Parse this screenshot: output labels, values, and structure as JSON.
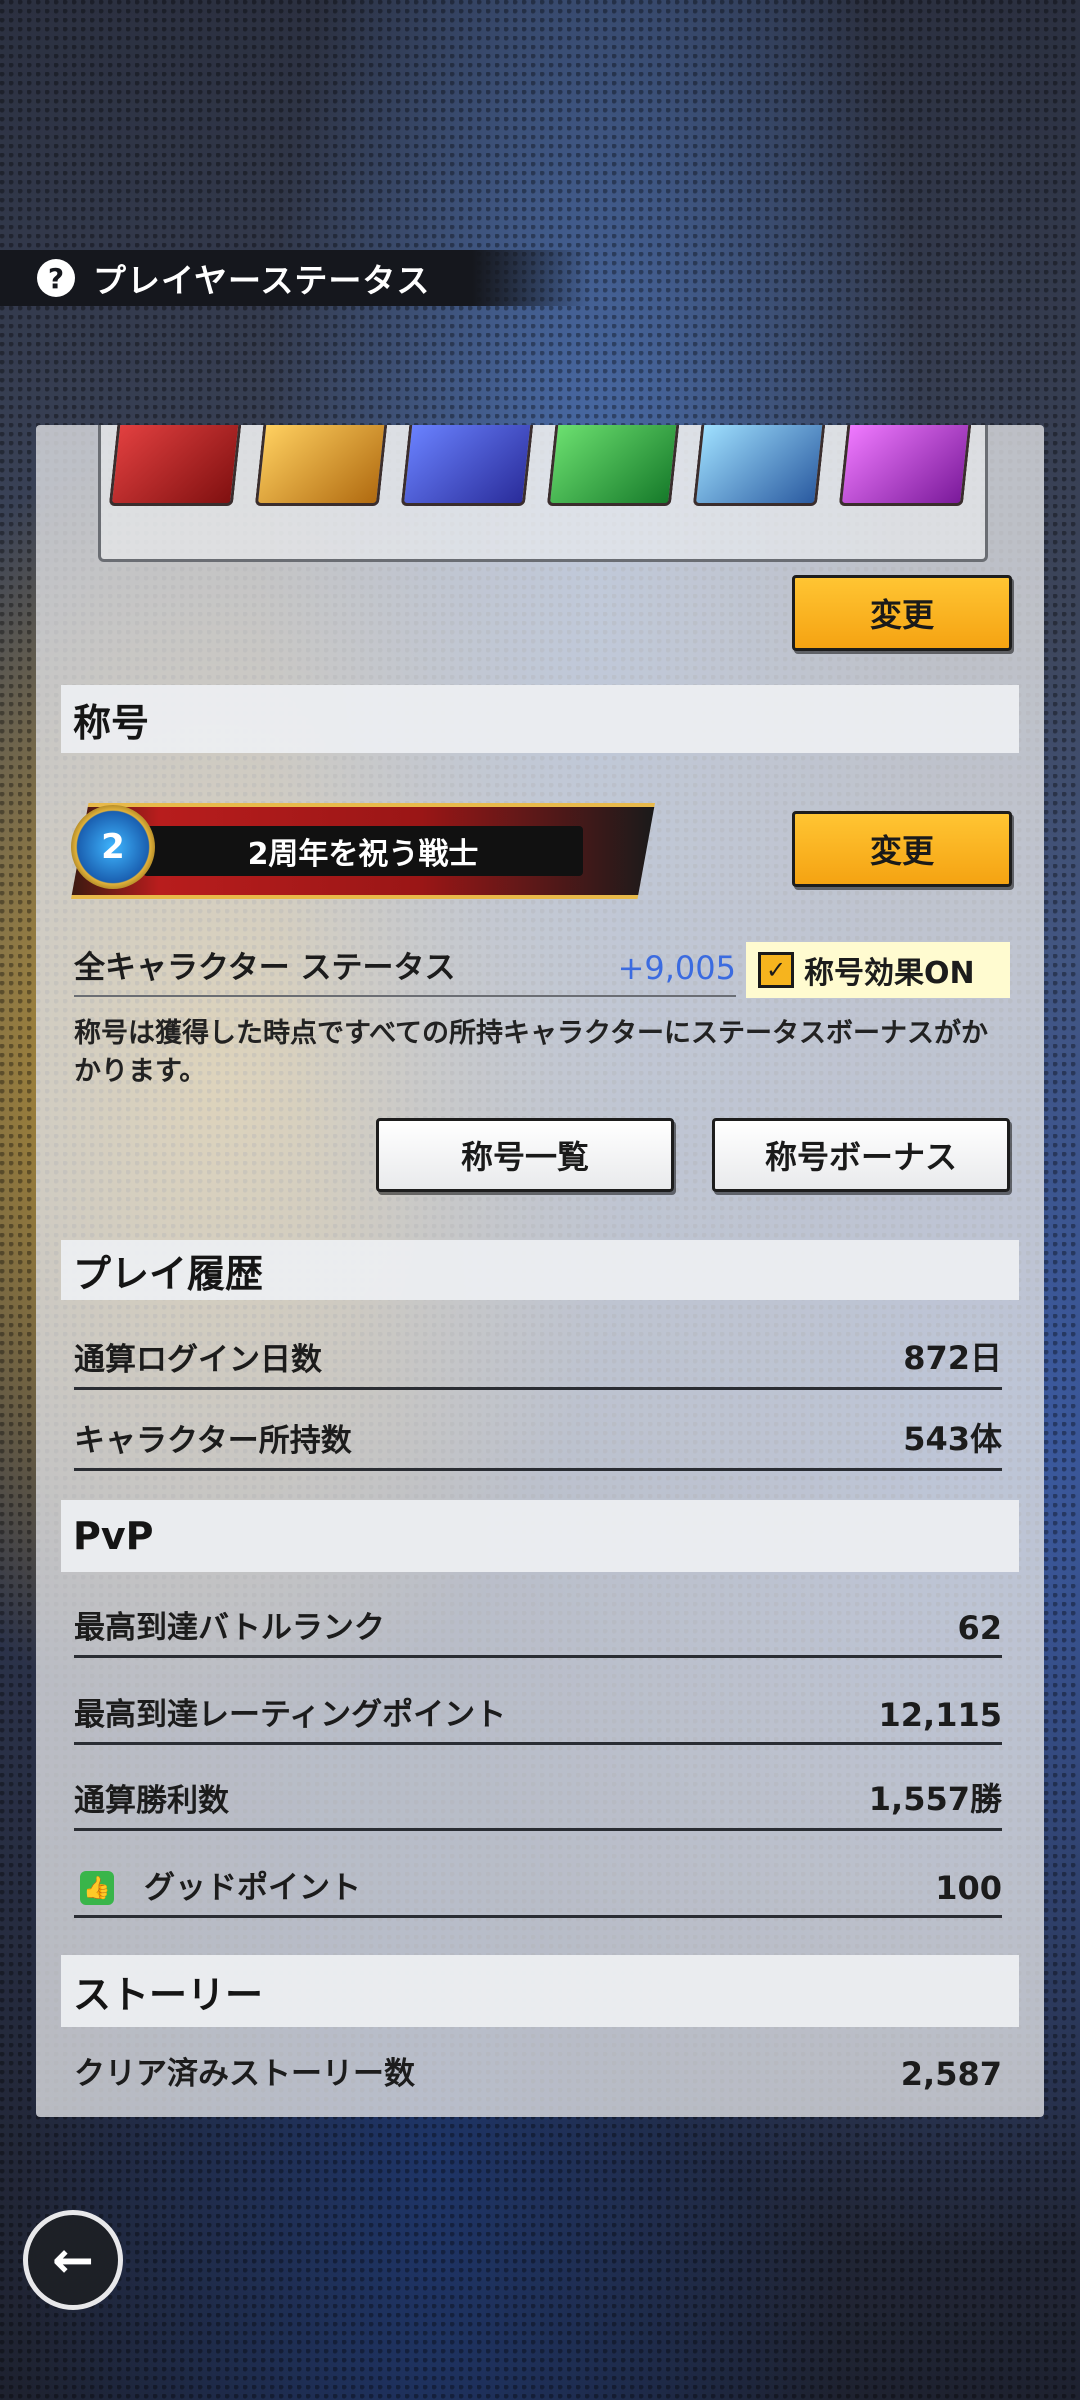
{
  "header": {
    "title": "プレイヤーステータス",
    "help_icon": "?"
  },
  "emblems": {
    "change_label": "変更",
    "colors": [
      "#c0202a",
      "#e6a11c",
      "#3b4fcf",
      "#2aa64a",
      "#5aaee0",
      "#c33bd0"
    ]
  },
  "title_section": {
    "heading": "称号",
    "current_title": "2周年を祝う戦士",
    "badge_text": "2",
    "change_label": "変更",
    "stat_label": "全キャラクター ステータス",
    "stat_value": "+9,005",
    "effect_toggle_label": "称号効果ON",
    "effect_toggle_checked": true,
    "description": "称号は獲得した時点ですべての所持キャラクターにステータスボーナスがかかります。",
    "list_button": "称号一覧",
    "bonus_button": "称号ボーナス"
  },
  "play_history": {
    "heading": "プレイ履歴",
    "rows": [
      {
        "label": "通算ログイン日数",
        "value": "872日"
      },
      {
        "label": "キャラクター所持数",
        "value": "543体"
      }
    ]
  },
  "pvp": {
    "heading": "PvP",
    "rows": [
      {
        "label": "最高到達バトルランク",
        "value": "62"
      },
      {
        "label": "最高到達レーティングポイント",
        "value": "12,115"
      },
      {
        "label": "通算勝利数",
        "value": "1,557勝"
      },
      {
        "label": "グッドポイント",
        "value": "100"
      }
    ]
  },
  "story": {
    "heading": "ストーリー",
    "rows": [
      {
        "label": "クリア済みストーリー数",
        "value": "2,587"
      }
    ]
  },
  "nav": {
    "back_icon": "←"
  }
}
